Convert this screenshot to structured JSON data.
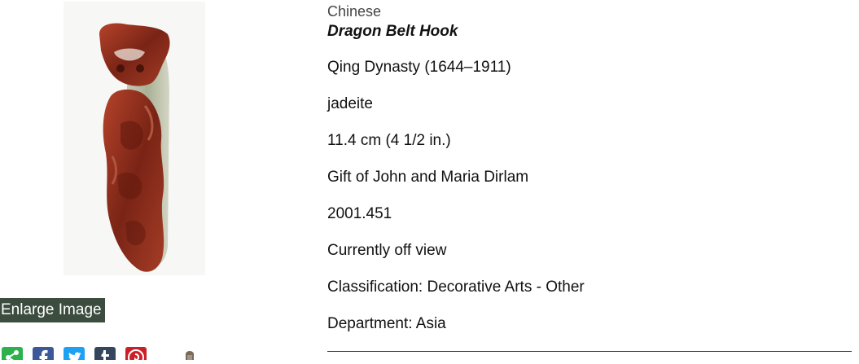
{
  "artwork": {
    "culture": "Chinese",
    "title": "Dragon Belt Hook",
    "date": "Qing Dynasty (1644–1911)",
    "medium": "jadeite",
    "dimensions": "11.4 cm (4 1/2 in.)",
    "credit_line": "Gift of John and Maria Dirlam",
    "accession_number": "2001.451",
    "location_status": "Currently off view",
    "classification": "Classification: Decorative Arts - Other",
    "department": "Department: Asia"
  },
  "image_controls": {
    "enlarge_label": "Enlarge Image"
  },
  "share": {
    "icons": [
      "share-icon",
      "facebook-icon",
      "twitter-icon",
      "tumblr-icon",
      "pinterest-icon"
    ],
    "colors": {
      "share": "#2bb24c",
      "facebook": "#3b5998",
      "twitter": "#1da1f2",
      "tumblr": "#35465c",
      "pinterest": "#cb2027"
    }
  },
  "colors": {
    "enlarge_bg": "#3c4c3e",
    "jade_red": "#8a2a1c",
    "jade_green": "#9aa58a"
  }
}
